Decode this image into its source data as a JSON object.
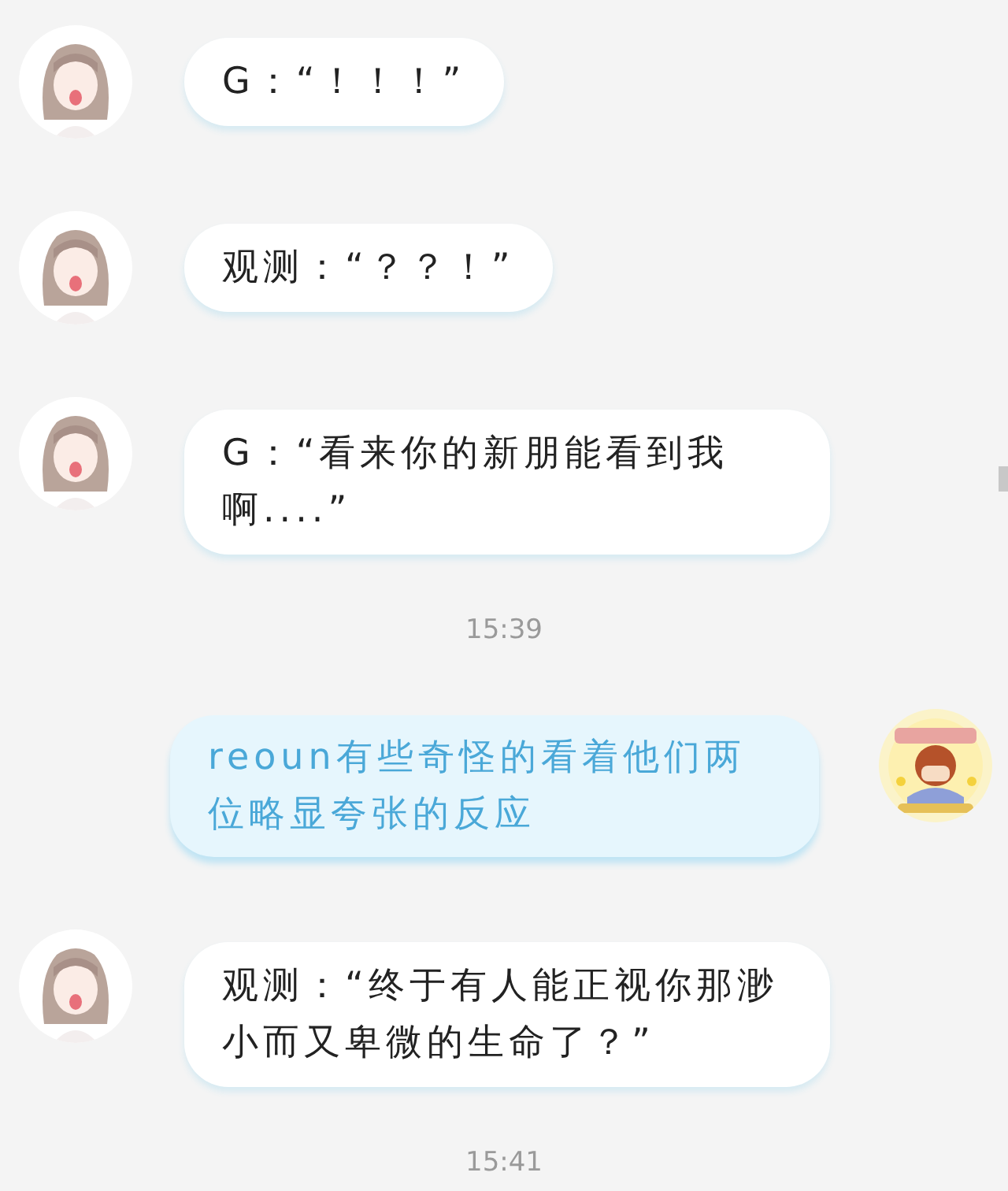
{
  "messages": [
    {
      "kind": "incoming",
      "text": "G：“！！！”"
    },
    {
      "kind": "incoming",
      "text": "观测：“？？！”"
    },
    {
      "kind": "incoming",
      "text": "G：“看来你的新朋能看到我啊....”"
    },
    {
      "kind": "time",
      "text": "15:39"
    },
    {
      "kind": "outgoing",
      "text": "reoun有些奇怪的看着他们两位略显夸张的反应"
    },
    {
      "kind": "incoming",
      "text": "观测：“终于有人能正视你那渺小而又卑微的生命了？”"
    },
    {
      "kind": "time",
      "text": "15:41"
    }
  ]
}
